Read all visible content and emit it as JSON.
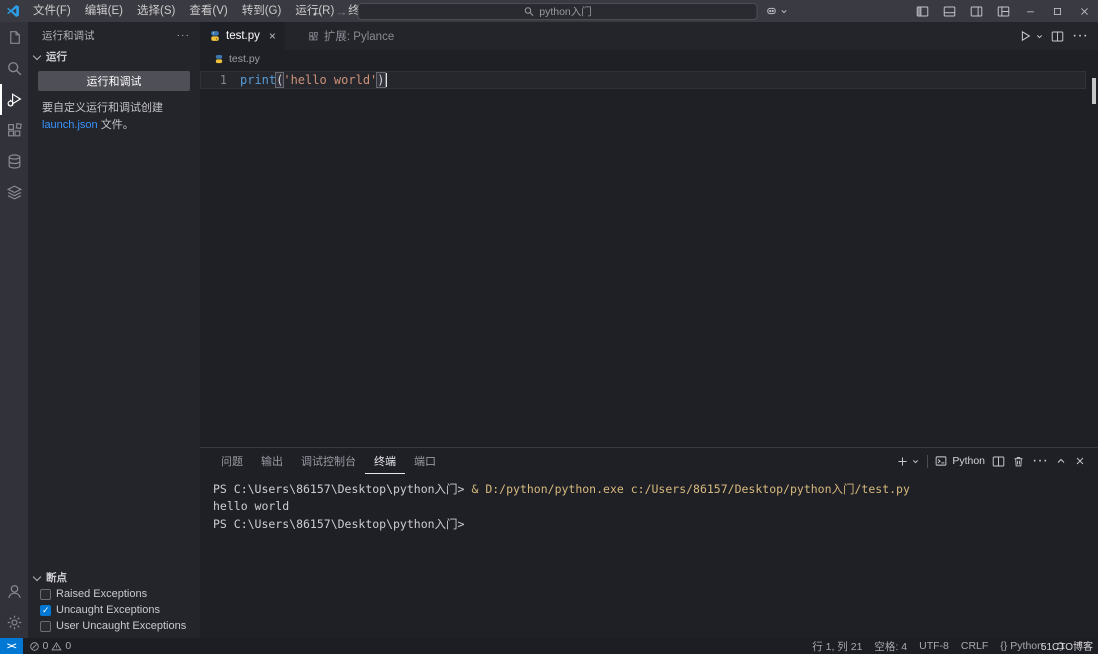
{
  "title_bar": {
    "menus": [
      "文件(F)",
      "编辑(E)",
      "选择(S)",
      "查看(V)",
      "转到(G)",
      "运行(R)",
      "终端(T)"
    ],
    "search_query": "python入门"
  },
  "icons": {
    "ellipsis": "···",
    "back_arrow": "←",
    "forward_arrow": "→",
    "remote_indicator": "><",
    "braces": "{}",
    "close": "×"
  },
  "sidebar": {
    "title": "运行和调试",
    "section_run": "运行",
    "run_button_label": "运行和调试",
    "hint_before": "要自定义运行和调试创建",
    "hint_link": "launch.json",
    "hint_after": "文件。",
    "breakpoints_title": "断点",
    "breakpoints": [
      {
        "label": "Raised Exceptions",
        "checked": false
      },
      {
        "label": "Uncaught Exceptions",
        "checked": true
      },
      {
        "label": "User Uncaught Exceptions",
        "checked": false
      }
    ]
  },
  "editor": {
    "tabs": [
      {
        "label": "test.py"
      },
      {
        "label": "扩展: Pylance"
      }
    ],
    "breadcrumb": "test.py",
    "code": {
      "line_number": "1",
      "function": "print",
      "paren_open": "(",
      "string": "'hello world'",
      "paren_close": ")"
    }
  },
  "panel": {
    "tabs": [
      "问题",
      "输出",
      "调试控制台",
      "终端",
      "端口"
    ],
    "active_tab": "终端",
    "terminal_name": "Python",
    "terminal": {
      "prompt": "PS C:\\Users\\86157\\Desktop\\python入门>",
      "command": "& D:/python/python.exe c:/Users/86157/Desktop/python入门/test.py",
      "output": "hello world"
    }
  },
  "status_bar": {
    "errors": "0",
    "warnings": "0",
    "cursor_position": "行 1, 列 21",
    "indentation": "空格: 4",
    "encoding": "UTF-8",
    "eol": "CRLF",
    "language": "Python"
  },
  "watermark": "51CTO博客",
  "colors": {
    "accent": "#0078d4",
    "link": "#3794ff",
    "function": "#569cd6",
    "string": "#ce9178",
    "command": "#d7ba7d"
  }
}
